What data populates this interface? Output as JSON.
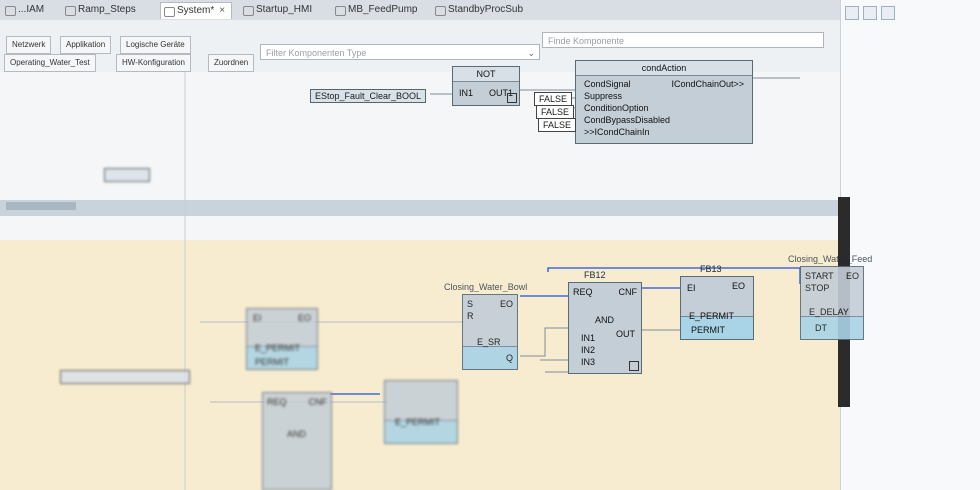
{
  "tabs": [
    {
      "label": "...IAM",
      "active": false
    },
    {
      "label": "Ramp_Steps",
      "active": false
    },
    {
      "label": "System*",
      "active": true
    },
    {
      "label": "Startup_HMI",
      "active": false
    },
    {
      "label": "MB_FeedPump",
      "active": false
    },
    {
      "label": "StandbyProcSub",
      "active": false
    }
  ],
  "close_glyph": "×",
  "toolbar": {
    "row1": [
      "Netzwerk",
      "Applikation",
      "Logische Geräte"
    ],
    "row2": [
      "Operating_Water_Test",
      "HW-Konfiguration",
      "Zuordnen"
    ],
    "filter_placeholder": "Filter Komponenten Type",
    "find_placeholder": "Finde Komponente"
  },
  "blocks": {
    "not": {
      "type": "NOT",
      "in": "IN1",
      "out": "OUT1"
    },
    "cond": {
      "title": "condAction",
      "pins_in": [
        "CondSignal",
        "Suppress",
        "ConditionOption",
        "CondBypassDisabled",
        ">>ICondChainIn"
      ],
      "pin_out": "ICondChainOut>>"
    },
    "consts": [
      "FALSE",
      "FALSE",
      "FALSE"
    ],
    "input_var": "EStop_Fault_Clear_BOOL",
    "fb12": {
      "instance": "FB12",
      "type": "AND",
      "pins_in": [
        "REQ",
        "IN1",
        "IN2",
        "IN3"
      ],
      "pins_out": [
        "CNF",
        "OUT"
      ]
    },
    "fb13": {
      "instance": "FB13",
      "type": "E_PERMIT",
      "pins_in": [
        "EI",
        "PERMIT"
      ],
      "pins_out": [
        "EO"
      ]
    },
    "sr": {
      "instance": "Closing_Water_Bowl",
      "type": "E_SR",
      "pins_in": [
        "S",
        "R"
      ],
      "pins_out": [
        "EO",
        "Q"
      ]
    },
    "delay": {
      "instance": "Closing_Water_Feed",
      "type": "E_DELAY",
      "pins_in": [
        "START",
        "STOP",
        "DT"
      ],
      "pins_out": [
        "EO"
      ]
    },
    "blur1": {
      "type": "E_PERMIT",
      "pins": [
        "EI",
        "EO",
        "PERMIT"
      ]
    },
    "blur2": {
      "type": "E_PERMIT"
    },
    "blur3": {
      "type": "AND",
      "pins": [
        "REQ",
        "CNF"
      ]
    }
  },
  "colors": {
    "band": "#f7ecd0",
    "canvas": "#f4f6f8",
    "block": "#c4ced7",
    "wire_event": "#1f4fd6",
    "wire_data": "#7f8c97"
  }
}
